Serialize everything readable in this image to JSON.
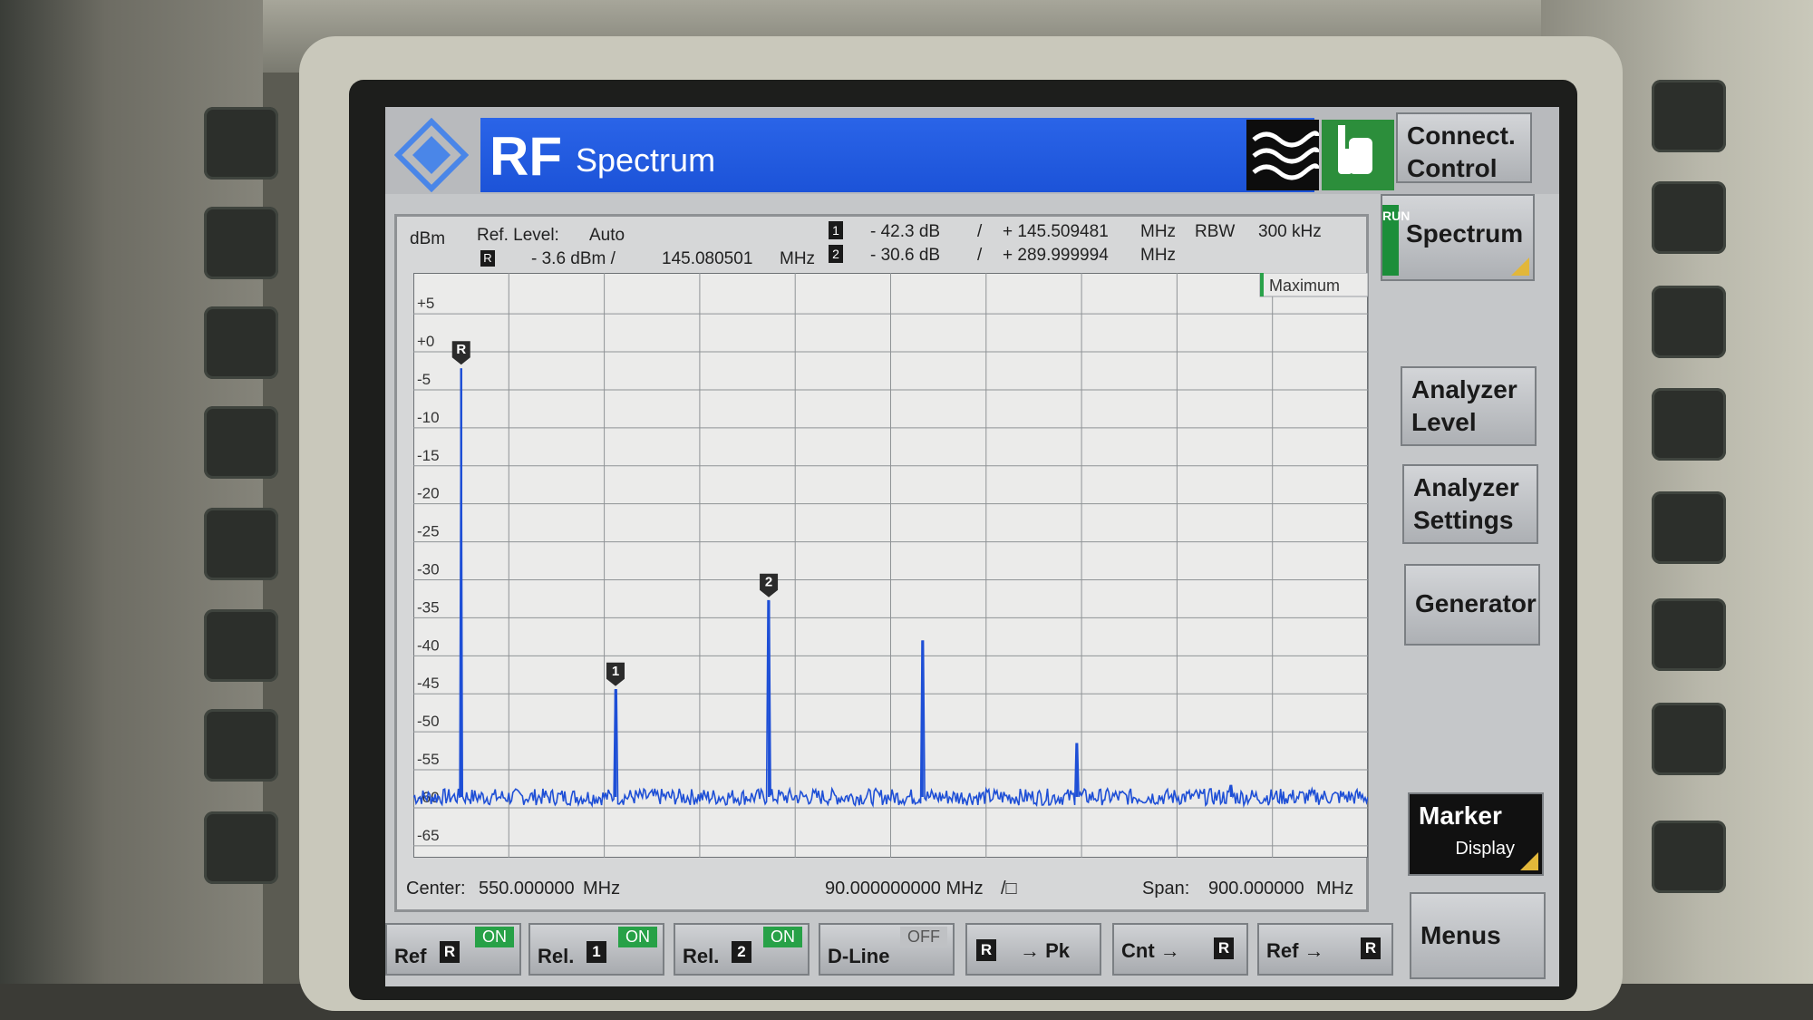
{
  "header": {
    "logo_icon": "rohde-schwarz-diamond-logo",
    "mode": "RF",
    "title": "Spectrum",
    "wave_icon": "wave-icon",
    "touch_icon": "hand-touch-icon"
  },
  "info": {
    "unit": "dBm",
    "ref_level_label": "Ref. Level:",
    "ref_level_value": "Auto",
    "ref_marker_symbol": "R",
    "ref_marker_reading": "- 3.6 dBm /",
    "ref_marker_freq": "145.080501",
    "ref_marker_unit": "MHz",
    "marker1_symbol": "1",
    "marker1_level": "- 42.3 dB",
    "marker1_sep": "/",
    "marker1_freq": "+ 145.509481",
    "marker1_unit": "MHz",
    "marker2_symbol": "2",
    "marker2_level": "- 30.6 dB",
    "marker2_sep": "/",
    "marker2_freq": "+ 289.999994",
    "marker2_unit": "MHz",
    "rbw_label": "RBW",
    "rbw_value": "300 kHz",
    "detector": "Maximum"
  },
  "footer": {
    "center_label": "Center:",
    "center_value": "550.000000",
    "center_unit": "MHz",
    "division_value": "90.000000000 MHz",
    "division_unit": "/□",
    "span_label": "Span:",
    "span_value": "900.000000",
    "span_unit": "MHz"
  },
  "softkeys_right": {
    "connect_line1": "Connect.",
    "connect_line2": "Control",
    "run_tag": "RUN",
    "spectrum": "Spectrum",
    "analyzer_level_line1": "Analyzer",
    "analyzer_level_line2": "Level",
    "analyzer_settings_line1": "Analyzer",
    "analyzer_settings_line2": "Settings",
    "generator": "Generator",
    "marker_line1": "Marker",
    "marker_line2": "Display",
    "menus": "Menus"
  },
  "softkeys_bottom": {
    "ref_label": "Ref",
    "ref_symbol": "R",
    "ref_state": "ON",
    "rel1_label": "Rel.",
    "rel1_symbol": "1",
    "rel1_state": "ON",
    "rel2_label": "Rel.",
    "rel2_symbol": "2",
    "rel2_state": "ON",
    "dline_label": "D-Line",
    "dline_state": "OFF",
    "peak_symbol": "R",
    "peak_label": "→ Pk",
    "cnt_label": "Cnt →",
    "cnt_symbol": "R",
    "ref2_label": "Ref →",
    "ref2_symbol": "R"
  },
  "chart_data": {
    "type": "line",
    "title": "",
    "xlabel": "",
    "ylabel": "dBm",
    "xlim": [
      100,
      1000
    ],
    "ylim": [
      -68,
      8
    ],
    "grid": true,
    "y_ticks": [
      "+5",
      "+0",
      "-5",
      "-10",
      "-15",
      "-20",
      "-25",
      "-30",
      "-35",
      "-40",
      "-45",
      "-50",
      "-55",
      "-60",
      "-65"
    ],
    "y_tick_values": [
      5,
      0,
      -5,
      -10,
      -15,
      -20,
      -25,
      -30,
      -35,
      -40,
      -45,
      -50,
      -55,
      -60,
      -65
    ],
    "noise_floor": -60,
    "x_unit": "MHz",
    "series": [
      {
        "x": [
          145.08,
          290.6,
          435.3,
          580.0,
          725.5,
          871.0,
          1016.5
        ],
        "values": [
          -3.6,
          -45.9,
          -34.2,
          -39.5,
          -53.0,
          -58.5,
          -55.5
        ]
      }
    ],
    "markers": [
      {
        "label": "R",
        "x": 145.08,
        "y": -3.6
      },
      {
        "label": "1",
        "x": 290.6,
        "y": -45.9
      },
      {
        "label": "2",
        "x": 435.1,
        "y": -34.2
      }
    ]
  }
}
